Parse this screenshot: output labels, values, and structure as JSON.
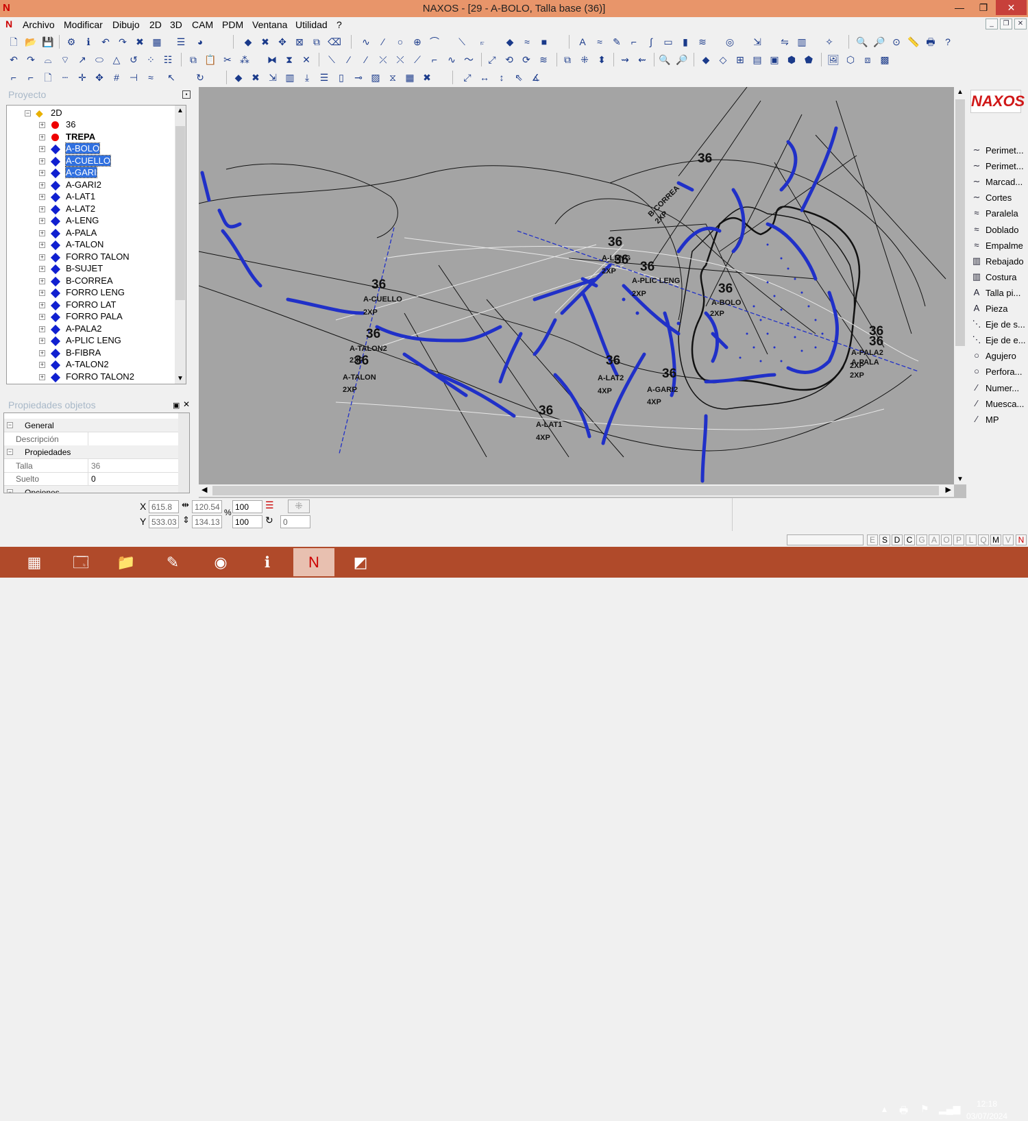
{
  "window": {
    "title": "NAXOS - [29 - A-BOLO, Talla base (36)]",
    "min_glyph": "—",
    "max_glyph": "❐",
    "close_glyph": "✕"
  },
  "menu": [
    "Archivo",
    "Modificar",
    "Dibujo",
    "2D",
    "3D",
    "CAM",
    "PDM",
    "Ventana",
    "Utilidad",
    "?"
  ],
  "project_panel": {
    "title": "Proyecto",
    "root": "2D",
    "items": [
      {
        "label": "36",
        "color": "red",
        "selected": false,
        "bold": false
      },
      {
        "label": "TREPA",
        "color": "red",
        "selected": false,
        "bold": true
      },
      {
        "label": "A-BOLO",
        "color": "blue",
        "selected": true,
        "bold": false
      },
      {
        "label": "A-CUELLO",
        "color": "blue",
        "selected": true,
        "bold": false
      },
      {
        "label": "A-GARI",
        "color": "blue",
        "selected": true,
        "bold": false
      },
      {
        "label": "A-GARI2",
        "color": "blue",
        "selected": false,
        "bold": false
      },
      {
        "label": "A-LAT1",
        "color": "blue",
        "selected": false,
        "bold": false
      },
      {
        "label": "A-LAT2",
        "color": "blue",
        "selected": false,
        "bold": false
      },
      {
        "label": "A-LENG",
        "color": "blue",
        "selected": false,
        "bold": false
      },
      {
        "label": "A-PALA",
        "color": "blue",
        "selected": false,
        "bold": false
      },
      {
        "label": "A-TALON",
        "color": "blue",
        "selected": false,
        "bold": false
      },
      {
        "label": "FORRO TALON",
        "color": "blue",
        "selected": false,
        "bold": false
      },
      {
        "label": "B-SUJET",
        "color": "blue",
        "selected": false,
        "bold": false
      },
      {
        "label": "B-CORREA",
        "color": "blue",
        "selected": false,
        "bold": false
      },
      {
        "label": "FORRO LENG",
        "color": "blue",
        "selected": false,
        "bold": false
      },
      {
        "label": "FORRO LAT",
        "color": "blue",
        "selected": false,
        "bold": false
      },
      {
        "label": "FORRO PALA",
        "color": "blue",
        "selected": false,
        "bold": false
      },
      {
        "label": "A-PALA2",
        "color": "blue",
        "selected": false,
        "bold": false
      },
      {
        "label": "A-PLIC LENG",
        "color": "blue",
        "selected": false,
        "bold": false
      },
      {
        "label": "B-FIBRA",
        "color": "blue",
        "selected": false,
        "bold": false
      },
      {
        "label": "A-TALON2",
        "color": "blue",
        "selected": false,
        "bold": false
      },
      {
        "label": "FORRO TALON2",
        "color": "blue",
        "selected": false,
        "bold": false
      }
    ]
  },
  "props_panel": {
    "title": "Propiedades objetos",
    "rows": [
      {
        "kind": "cat",
        "label": "General"
      },
      {
        "kind": "prop",
        "label": "Descripción",
        "value": ""
      },
      {
        "kind": "cat",
        "label": "Propiedades"
      },
      {
        "kind": "prop",
        "label": "Talla",
        "value": "36"
      },
      {
        "kind": "prop",
        "label": "Suelto",
        "value": "0"
      },
      {
        "kind": "cat",
        "label": "Opciones"
      }
    ]
  },
  "canvas": {
    "labels": [
      {
        "t": "36",
        "big": true
      },
      {
        "t": "B-CORREA",
        "big": false
      },
      {
        "t": "2XP",
        "big": false
      },
      {
        "t": "36",
        "big": true
      },
      {
        "t": "A-LENG",
        "big": false
      },
      {
        "t": "2XP",
        "big": false
      },
      {
        "t": "36",
        "big": true
      },
      {
        "t": "36",
        "big": true
      },
      {
        "t": "A-PLIC LENG",
        "big": false
      },
      {
        "t": "2XP",
        "big": false
      },
      {
        "t": "36",
        "big": true
      },
      {
        "t": "A-BOLO",
        "big": false
      },
      {
        "t": "2XP",
        "big": false
      },
      {
        "t": "36",
        "big": true
      },
      {
        "t": "A-CUELLO",
        "big": false
      },
      {
        "t": "2XP",
        "big": false
      },
      {
        "t": "36",
        "big": true
      },
      {
        "t": "A-TALON2",
        "big": false
      },
      {
        "t": "2XP",
        "big": false
      },
      {
        "t": "36",
        "big": true
      },
      {
        "t": "A-TALON",
        "big": false
      },
      {
        "t": "2XP",
        "big": false
      },
      {
        "t": "36",
        "big": true
      },
      {
        "t": "A-LAT2",
        "big": false
      },
      {
        "t": "4XP",
        "big": false
      },
      {
        "t": "36",
        "big": true
      },
      {
        "t": "A-GARI2",
        "big": false
      },
      {
        "t": "4XP",
        "big": false
      },
      {
        "t": "36",
        "big": true
      },
      {
        "t": "A-LAT1",
        "big": false
      },
      {
        "t": "4XP",
        "big": false
      },
      {
        "t": "36",
        "big": true
      },
      {
        "t": "36",
        "big": true
      },
      {
        "t": "A-PALA2",
        "big": false
      },
      {
        "t": "A-PALA",
        "big": false
      },
      {
        "t": "2XP",
        "big": false
      },
      {
        "t": "2XP",
        "big": false
      }
    ]
  },
  "right_panel": {
    "logo": "NAXOS",
    "items": [
      {
        "icon": "∼",
        "label": "Perimet..."
      },
      {
        "icon": "∼",
        "label": "Perimet..."
      },
      {
        "icon": "∼",
        "label": "Marcad..."
      },
      {
        "icon": "∼",
        "label": "Cortes"
      },
      {
        "icon": "≈",
        "label": "Paralela"
      },
      {
        "icon": "≈",
        "label": "Doblado"
      },
      {
        "icon": "≈",
        "label": "Empalme"
      },
      {
        "icon": "▥",
        "label": "Rebajado"
      },
      {
        "icon": "▥",
        "label": "Costura"
      },
      {
        "icon": "A",
        "label": "Talla pi..."
      },
      {
        "icon": "A",
        "label": "Pieza"
      },
      {
        "icon": "⋱",
        "label": "Eje de s..."
      },
      {
        "icon": "⋱",
        "label": "Eje de e..."
      },
      {
        "icon": "○",
        "label": "Agujero"
      },
      {
        "icon": "○",
        "label": "Perfora..."
      },
      {
        "icon": "∕",
        "label": "Numer..."
      },
      {
        "icon": "∕",
        "label": "Muesca..."
      },
      {
        "icon": "∕",
        "label": "MP"
      }
    ]
  },
  "status": {
    "x_label": "X",
    "y_label": "Y",
    "x": "615.8",
    "y": "533.03",
    "dx": "120.54",
    "dy": "134.13",
    "pct_label": "%",
    "scale_x": "100",
    "scale_y": "100",
    "rot": "0"
  },
  "layers": [
    "E",
    "S",
    "D",
    "C",
    "G",
    "A",
    "O",
    "P",
    "L",
    "Q",
    "M",
    "V"
  ],
  "clock": {
    "time": "12:18",
    "date": "03/07/2024"
  },
  "colors": {
    "titlebar": "#e8956a",
    "canvas": "#a4a4a4",
    "piece": "#2030c8",
    "taskbar": "#b04a2a"
  }
}
